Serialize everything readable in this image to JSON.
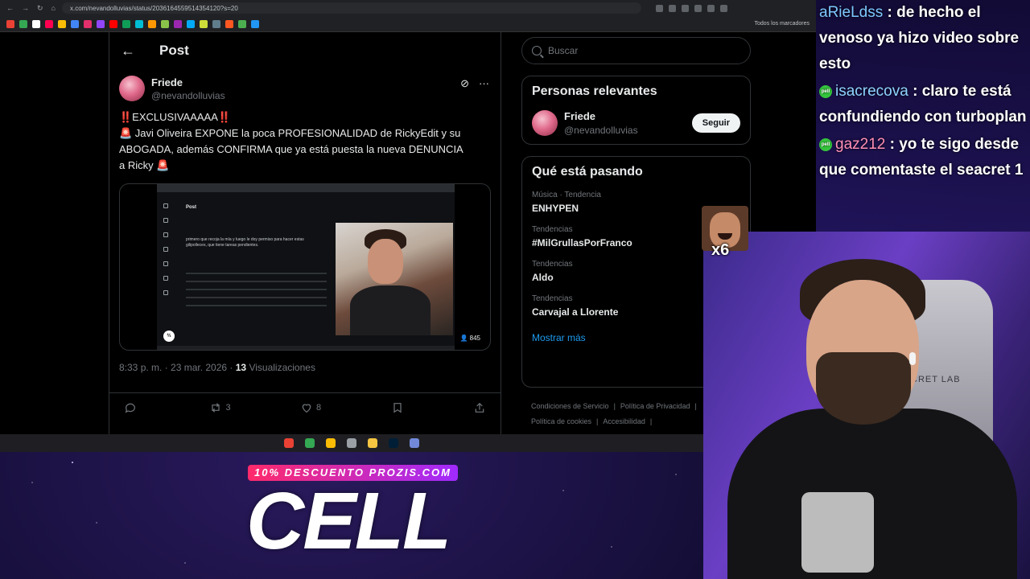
{
  "browser": {
    "url": "x.com/nevandolluvias/status/2036164559514354120?s=20",
    "bookmarks_all": "Todos los marcadores"
  },
  "post": {
    "header_title": "Post",
    "author_name": "Friede",
    "author_handle": "@nevandolluvias",
    "text_lines": [
      "‼️EXCLUSIVAAAAA‼️",
      "🚨 Javi Oliveira EXPONE la poca PROFESIONALIDAD de RickyEdit y su",
      "ABOGADA, además CONFIRMA que ya está puesta la nueva DENUNCIA",
      "a Ricky 🚨"
    ],
    "media": {
      "inner_post_label": "Post",
      "inner_text": "primero que recoja la mía y luego le doy permiso para hacer estas gilipolleces, que tiene tareas pendientes.",
      "views_badge": "845"
    },
    "timestamp": "8:33 p. m. · 23 mar. 2026 · ",
    "views_count": "13",
    "views_label": " Visualizaciones",
    "actions": {
      "reply_count": "",
      "repost_count": "3",
      "like_count": "8"
    }
  },
  "sidebar": {
    "search_placeholder": "Buscar",
    "relevant_title": "Personas relevantes",
    "relevant_person": {
      "name": "Friede",
      "handle": "@nevandolluvias",
      "follow_label": "Seguir"
    },
    "trends_title": "Qué está pasando",
    "trends": [
      {
        "category": "Música · Tendencia",
        "name": "ENHYPEN"
      },
      {
        "category": "Tendencias",
        "name": "#MilGrullasPorFranco"
      },
      {
        "category": "Tendencias",
        "name": "Aldo"
      },
      {
        "category": "Tendencias",
        "name": "Carvajal a Llorente"
      }
    ],
    "show_more": "Mostrar más",
    "footer": [
      "Condiciones de Servicio",
      "|",
      "Política de Privacidad",
      "|",
      "Política de cookies",
      "|",
      "Accesibilidad",
      "|"
    ]
  },
  "chat": [
    {
      "user": "aRieLdss",
      "message": " : de hecho el venoso ya hizo video sobre esto",
      "user_color": "#7ec8ff"
    },
    {
      "user": "isacrecova",
      "message": " : claro te está confundiendo con turboplan",
      "user_color": "#8fd3ff"
    },
    {
      "user": "gaz212",
      "message": " : yo te sigo desde que comentaste el seacret 1",
      "user_color": "#ff8fb5"
    }
  ],
  "overlay": {
    "emote_count": "x6",
    "promo_tag": "10% DESCUENTO PROZIS.COM",
    "promo_big": "CELL",
    "chair_label": "CRET LAB"
  },
  "colors": {
    "accent": "#1d9bf0",
    "background": "#000000",
    "promo_gradient": [
      "#ff2a6a",
      "#a02aff"
    ]
  }
}
